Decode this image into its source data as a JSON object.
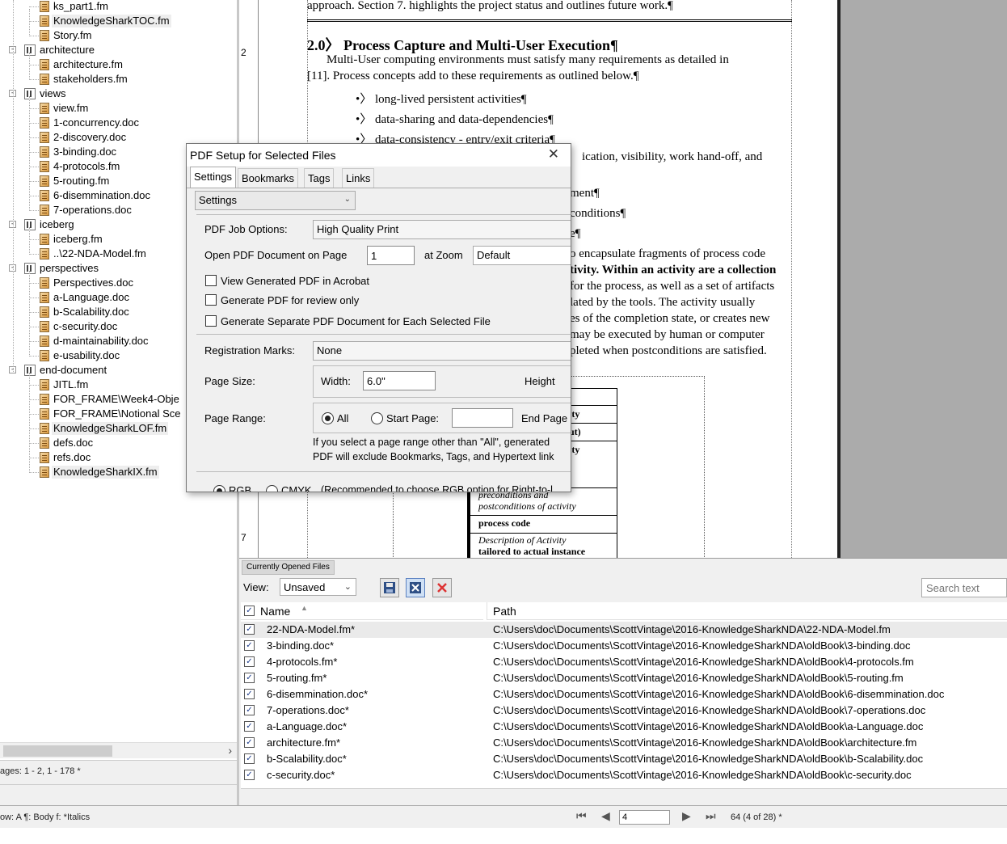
{
  "tree": {
    "items": [
      {
        "label": "ks_part1.fm",
        "type": "file",
        "depth": 2
      },
      {
        "label": "KnowledgeSharkTOC.fm",
        "type": "file",
        "depth": 2
      },
      {
        "label": "Story.fm",
        "type": "file",
        "depth": 2
      },
      {
        "label": "architecture",
        "type": "folder",
        "depth": 1
      },
      {
        "label": "architecture.fm",
        "type": "file",
        "depth": 2
      },
      {
        "label": "stakeholders.fm",
        "type": "file",
        "depth": 2
      },
      {
        "label": "views",
        "type": "folder",
        "depth": 1
      },
      {
        "label": "view.fm",
        "type": "file",
        "depth": 2
      },
      {
        "label": "1-concurrency.doc",
        "type": "file",
        "depth": 2
      },
      {
        "label": "2-discovery.doc",
        "type": "file",
        "depth": 2
      },
      {
        "label": "3-binding.doc",
        "type": "file",
        "depth": 2
      },
      {
        "label": "4-protocols.fm",
        "type": "file",
        "depth": 2
      },
      {
        "label": "5-routing.fm",
        "type": "file",
        "depth": 2
      },
      {
        "label": "6-disemmination.doc",
        "type": "file",
        "depth": 2
      },
      {
        "label": "7-operations.doc",
        "type": "file",
        "depth": 2
      },
      {
        "label": "iceberg",
        "type": "folder",
        "depth": 1
      },
      {
        "label": "iceberg.fm",
        "type": "file",
        "depth": 2
      },
      {
        "label": "..\\22-NDA-Model.fm",
        "type": "file",
        "depth": 2
      },
      {
        "label": "perspectives",
        "type": "folder",
        "depth": 1
      },
      {
        "label": "Perspectives.doc",
        "type": "file",
        "depth": 2
      },
      {
        "label": "a-Language.doc",
        "type": "file",
        "depth": 2
      },
      {
        "label": "b-Scalability.doc",
        "type": "file",
        "depth": 2
      },
      {
        "label": "c-security.doc",
        "type": "file",
        "depth": 2
      },
      {
        "label": "d-maintainability.doc",
        "type": "file",
        "depth": 2
      },
      {
        "label": "e-usability.doc",
        "type": "file",
        "depth": 2
      },
      {
        "label": "end-document",
        "type": "folder",
        "depth": 1
      },
      {
        "label": "JITL.fm",
        "type": "file",
        "depth": 2
      },
      {
        "label": "FOR_FRAME\\Week4-Obje",
        "type": "file",
        "depth": 2
      },
      {
        "label": "FOR_FRAME\\Notional Sce",
        "type": "file",
        "depth": 2
      },
      {
        "label": "KnowledgeSharkLOF.fm",
        "type": "file",
        "depth": 2
      },
      {
        "label": "defs.doc",
        "type": "file",
        "depth": 2
      },
      {
        "label": "refs.doc",
        "type": "file",
        "depth": 2
      },
      {
        "label": "KnowledgeSharkIX.fm",
        "type": "file",
        "depth": 2
      }
    ],
    "pages_text": "ages: 1 - 2, 1 - 178 *"
  },
  "document": {
    "ruler_numbers": [
      "2",
      "7"
    ],
    "lines": [
      {
        "text": "approach. Section 7. highlights the project status and outlines future work.¶"
      },
      {
        "text": "2.0〉  Process Capture and Multi-User Execution¶"
      },
      {
        "text": "Multi-User computing environments must satisfy many requirements as detailed in"
      },
      {
        "text": "[11]. Process concepts add to these requirements as outlined below.¶"
      },
      {
        "text": "•〉   long-lived persistent activities¶"
      },
      {
        "text": "•〉   data-sharing and data-dependencies¶"
      },
      {
        "text": "•〉   data-consistency - entry/exit criteria¶"
      },
      {
        "text": "ication, visibility, work hand-off, and"
      },
      {
        "text": "ment¶"
      },
      {
        "text": "conditions¶"
      },
      {
        "text": "e¶"
      },
      {
        "text": "o encapsulate fragments of process code"
      },
      {
        "text": "tivity. Within an activity are a collection"
      },
      {
        "text": "for the process, as well as a set of artifacts"
      },
      {
        "text": "lated by the tools. The activity usually"
      },
      {
        "text": "es of the completion state, or creates new"
      },
      {
        "text": "may be executed by human or computer"
      },
      {
        "text": "pleted when postconditions are satisfied."
      }
    ],
    "table_cells": [
      "ity",
      "ut)",
      "ity",
      "preconditions and",
      "postconditions of activity",
      "process code",
      "Description of Activity",
      "tailored to actual instance"
    ]
  },
  "panel": {
    "tab": "Currently Opened Files",
    "view_label": "View:",
    "view_value": "Unsaved",
    "search_placeholder": "Search text",
    "col_name": "Name",
    "col_path": "Path",
    "rows": [
      {
        "name": "22-NDA-Model.fm*",
        "path": "C:\\Users\\doc\\Documents\\ScottVintage\\2016-KnowledgeSharkNDA\\22-NDA-Model.fm"
      },
      {
        "name": "3-binding.doc*",
        "path": "C:\\Users\\doc\\Documents\\ScottVintage\\2016-KnowledgeSharkNDA\\oldBook\\3-binding.doc"
      },
      {
        "name": "4-protocols.fm*",
        "path": "C:\\Users\\doc\\Documents\\ScottVintage\\2016-KnowledgeSharkNDA\\oldBook\\4-protocols.fm"
      },
      {
        "name": "5-routing.fm*",
        "path": "C:\\Users\\doc\\Documents\\ScottVintage\\2016-KnowledgeSharkNDA\\oldBook\\5-routing.fm"
      },
      {
        "name": "6-disemmination.doc*",
        "path": "C:\\Users\\doc\\Documents\\ScottVintage\\2016-KnowledgeSharkNDA\\oldBook\\6-disemmination.doc"
      },
      {
        "name": "7-operations.doc*",
        "path": "C:\\Users\\doc\\Documents\\ScottVintage\\2016-KnowledgeSharkNDA\\oldBook\\7-operations.doc"
      },
      {
        "name": "a-Language.doc*",
        "path": "C:\\Users\\doc\\Documents\\ScottVintage\\2016-KnowledgeSharkNDA\\oldBook\\a-Language.doc"
      },
      {
        "name": "architecture.fm*",
        "path": "C:\\Users\\doc\\Documents\\ScottVintage\\2016-KnowledgeSharkNDA\\oldBook\\architecture.fm"
      },
      {
        "name": "b-Scalability.doc*",
        "path": "C:\\Users\\doc\\Documents\\ScottVintage\\2016-KnowledgeSharkNDA\\oldBook\\b-Scalability.doc"
      },
      {
        "name": "c-security.doc*",
        "path": "C:\\Users\\doc\\Documents\\ScottVintage\\2016-KnowledgeSharkNDA\\oldBook\\c-security.doc"
      }
    ]
  },
  "status": {
    "left": "ow: A  ¶: Body  f: *Italics",
    "page_value": "4",
    "page_count": "64 (4 of 28) *"
  },
  "dialog": {
    "title": "PDF Setup for Selected Files",
    "tabs": [
      "Settings",
      "Bookmarks",
      "Tags",
      "Links"
    ],
    "settings_select": "Settings",
    "job_options_label": "PDF Job Options:",
    "job_options_value": "High Quality Print",
    "open_page_label": "Open PDF Document on Page",
    "open_page_value": "1",
    "zoom_label": "at Zoom",
    "zoom_value": "Default",
    "cb_view": "View Generated PDF in Acrobat",
    "cb_review": "Generate PDF for review only",
    "cb_separate": "Generate Separate PDF Document for Each Selected File",
    "reg_marks_label": "Registration Marks:",
    "reg_marks_value": "None",
    "page_size_label": "Page Size:",
    "width_label": "Width:",
    "width_value": "6.0\"",
    "height_label": "Height",
    "page_range_label": "Page Range:",
    "all_label": "All",
    "start_label": "Start Page:",
    "end_label": "End Page",
    "note_line1": "If you select a page range other than \"All\", generated",
    "note_line2": "PDF will exclude Bookmarks, Tags, and Hypertext link",
    "rgb_label": "RGB",
    "cmyk_label": "CMYK",
    "color_note": "(Recommended to choose RGB option for Right-to-l"
  },
  "colors": {
    "accent": "#1a3a8a",
    "file_icon": "#d9983e",
    "canvas_bg": "#ababab"
  }
}
